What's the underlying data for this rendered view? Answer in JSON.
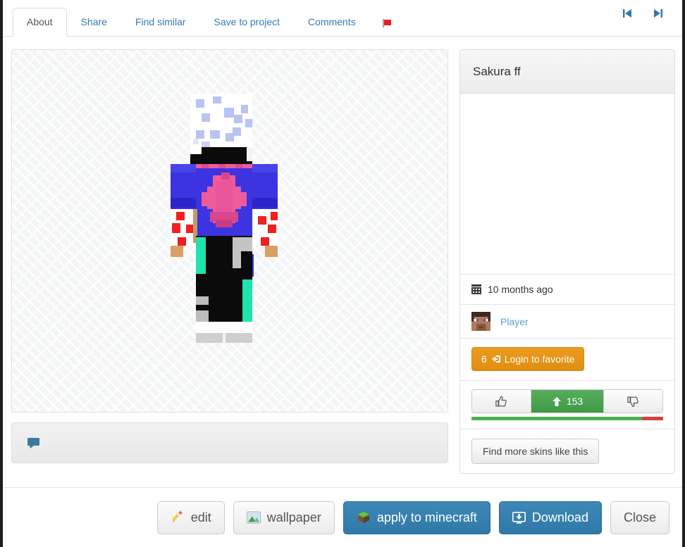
{
  "tabs": [
    {
      "label": "About",
      "active": true
    },
    {
      "label": "Share",
      "active": false
    },
    {
      "label": "Find similar",
      "active": false
    },
    {
      "label": "Save to project",
      "active": false
    },
    {
      "label": "Comments",
      "active": false
    }
  ],
  "tabbar": {
    "report_icon": "red-flag-icon",
    "prev_icon": "skip-previous-icon",
    "next_icon": "skip-next-icon"
  },
  "preview": {
    "alt": "minecraft-skin-preview",
    "background": "#f4f5f6"
  },
  "comment_bar": {
    "icon": "comment-bubble-icon"
  },
  "panel": {
    "title": "Sakura ff",
    "date_icon": "calendar-icon",
    "date_text": "10 months ago",
    "author_avatar_icon": "steve-avatar-icon",
    "author_name": "Player",
    "favorite": {
      "count": "6",
      "icon": "login-arrow-icon",
      "label": "Login to favorite"
    },
    "vote": {
      "up_icon": "thumbs-up-icon",
      "down_icon": "thumbs-down-icon",
      "score_icon": "up-arrow-icon",
      "score": "153",
      "ratio_up_percent": 89,
      "ratio_down_percent": 11
    },
    "find_more_label": "Find more skins like this"
  },
  "footer": {
    "buttons": [
      {
        "label": "edit",
        "icon": "pencil-icon",
        "style": "grey"
      },
      {
        "label": "wallpaper",
        "icon": "image-icon",
        "style": "grey"
      },
      {
        "label": "apply to minecraft",
        "icon": "grass-block-icon",
        "style": "blue"
      },
      {
        "label": "Download",
        "icon": "download-icon",
        "style": "blue"
      },
      {
        "label": "Close",
        "icon": "",
        "style": "grey"
      }
    ]
  },
  "colors": {
    "link": "#337ab7",
    "favorite_orange": "#e89217",
    "vote_green": "#4caf50",
    "vote_red": "#e03b3b",
    "primary_blue": "#2f78a8"
  }
}
